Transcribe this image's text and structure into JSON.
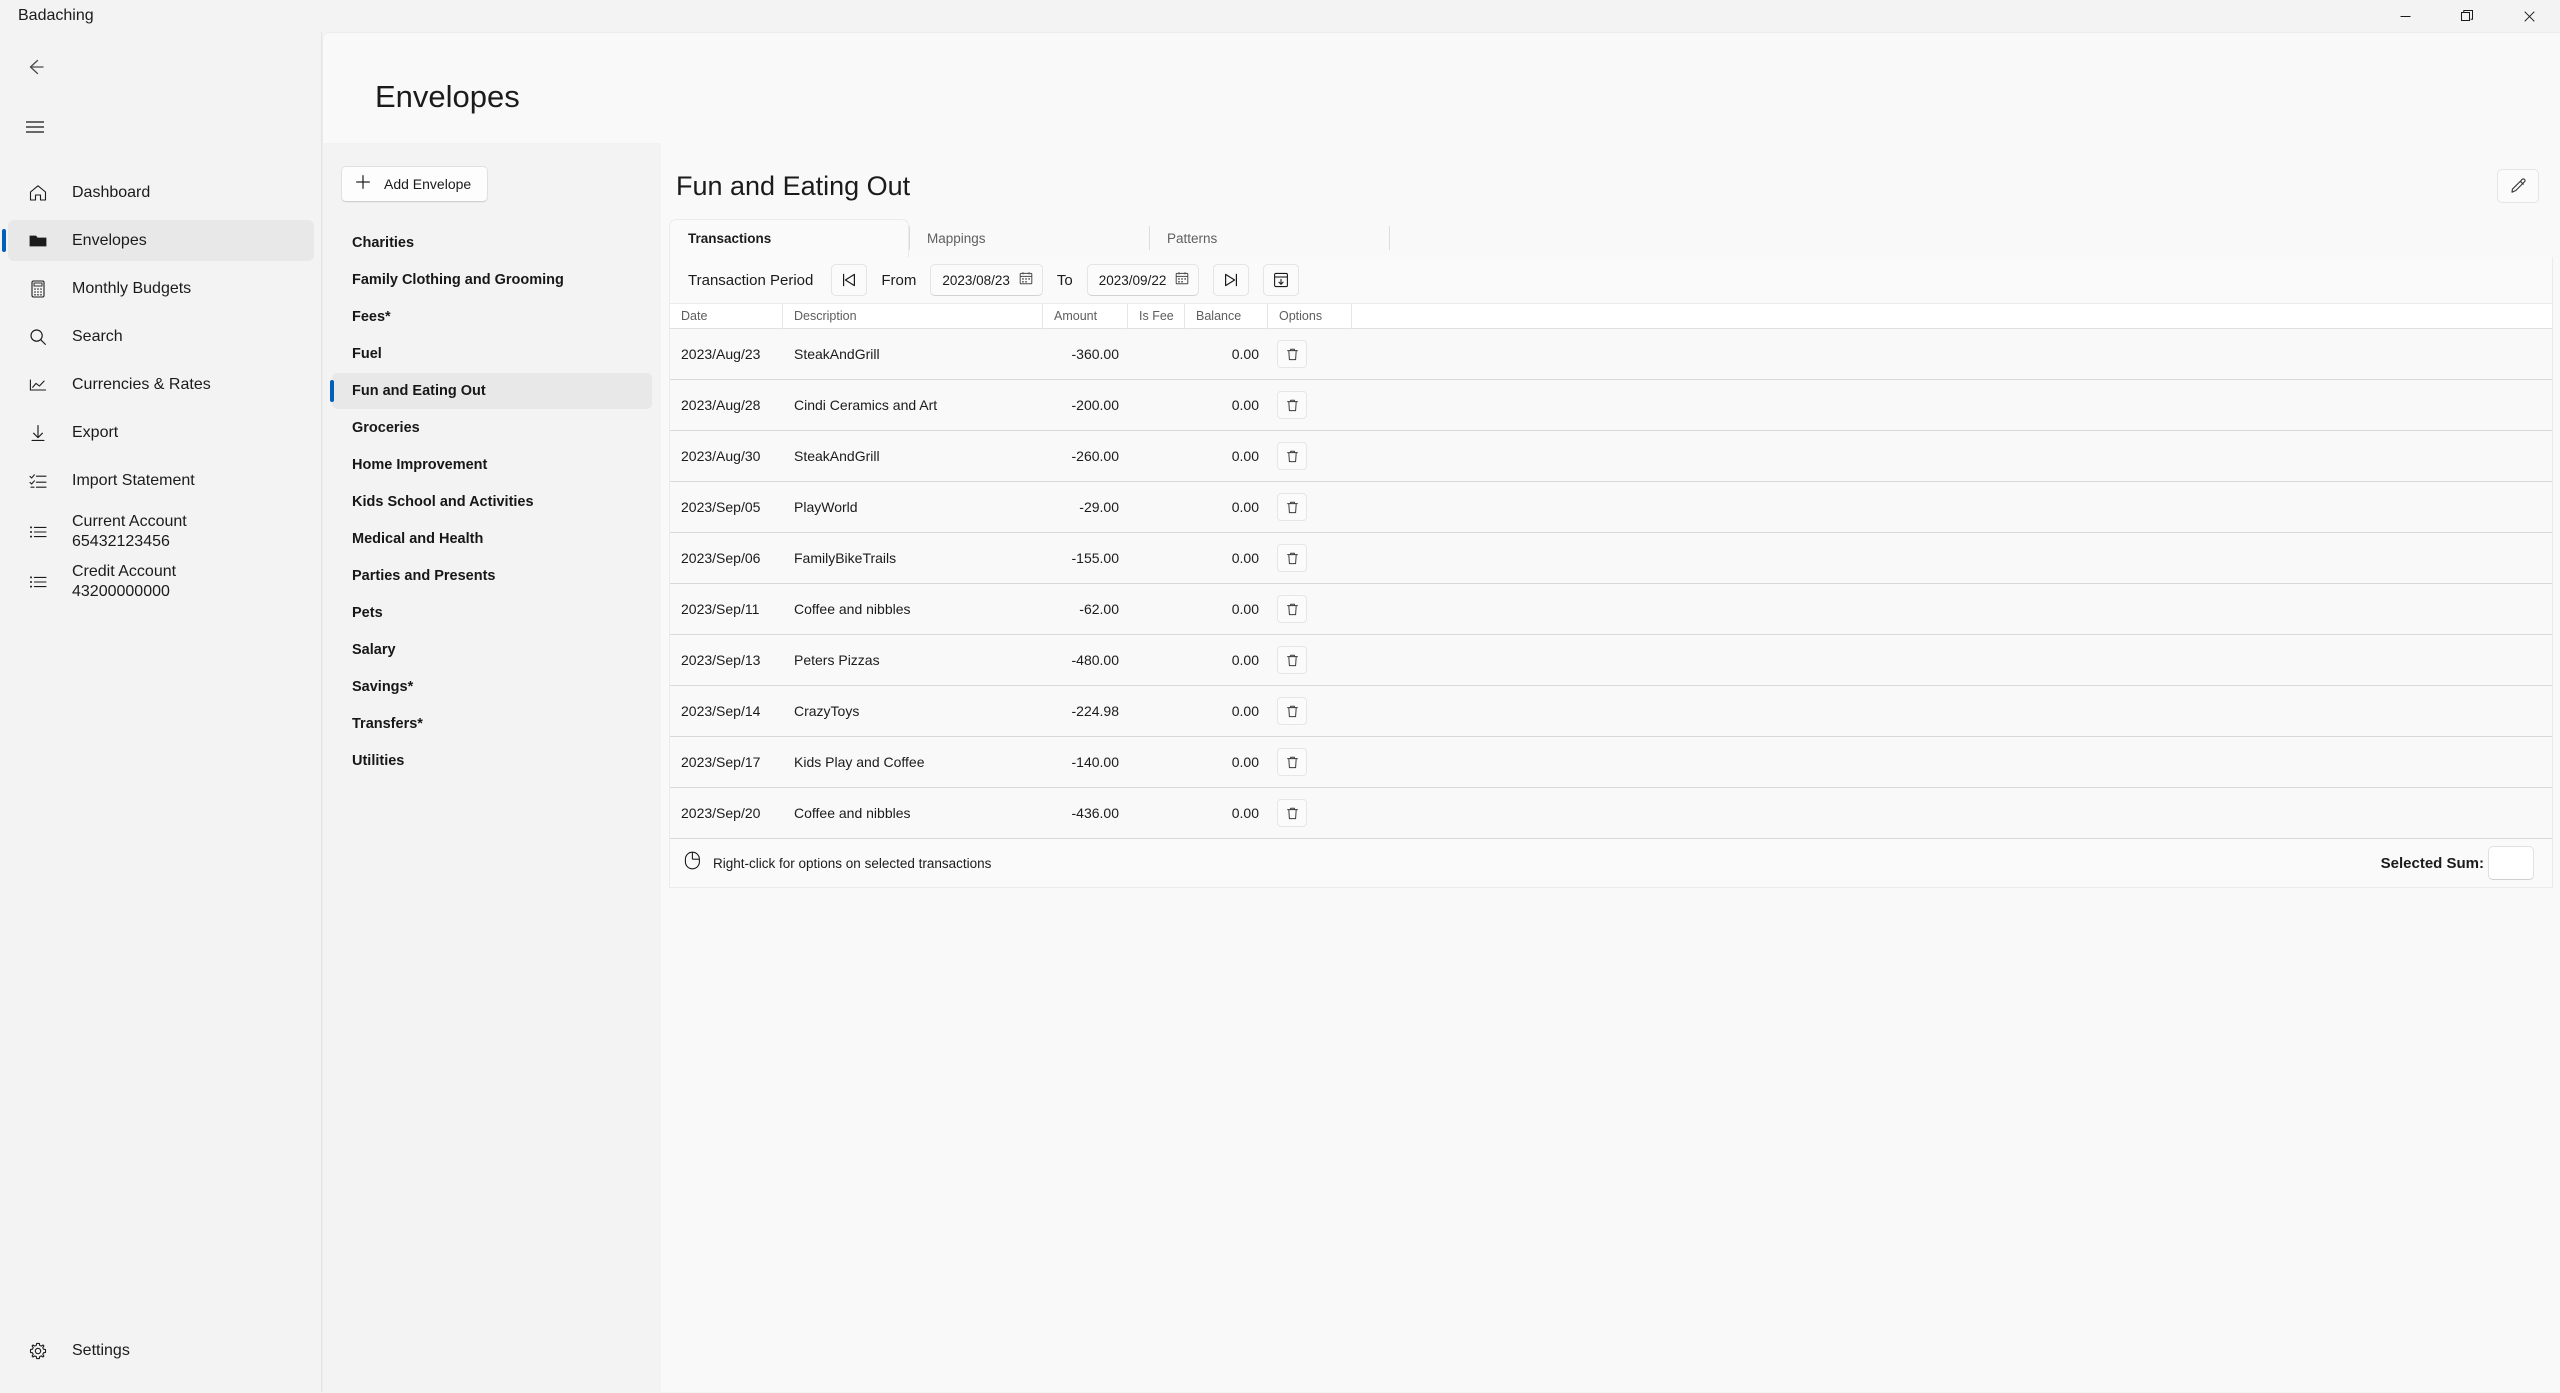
{
  "window": {
    "title": "Badaching",
    "minimize_label": "Minimize",
    "maximize_label": "Restore",
    "close_label": "Close"
  },
  "leftnav": {
    "back_label": "Back",
    "menu_label": "Navigation menu",
    "items": [
      {
        "label": "Dashboard",
        "icon": "home-icon",
        "selected": false
      },
      {
        "label": "Envelopes",
        "icon": "folder-icon",
        "selected": true
      },
      {
        "label": "Monthly Budgets",
        "icon": "calculator-icon",
        "selected": false
      },
      {
        "label": "Search",
        "icon": "search-icon",
        "selected": false
      },
      {
        "label": "Currencies & Rates",
        "icon": "chart-icon",
        "selected": false
      },
      {
        "label": "Export",
        "icon": "download-icon",
        "selected": false
      },
      {
        "label": "Import Statement",
        "icon": "checklist-icon",
        "selected": false
      },
      {
        "label": "Current Account\n65432123456",
        "icon": "list-icon",
        "selected": false
      },
      {
        "label": "Credit Account\n43200000000",
        "icon": "list-icon",
        "selected": false
      }
    ],
    "settings": {
      "label": "Settings",
      "icon": "gear-icon"
    }
  },
  "page": {
    "title": "Envelopes"
  },
  "envelopes": {
    "add_button": "Add Envelope",
    "items": [
      {
        "label": "Charities",
        "selected": false
      },
      {
        "label": "Family Clothing and Grooming",
        "selected": false
      },
      {
        "label": "Fees*",
        "selected": false
      },
      {
        "label": "Fuel",
        "selected": false
      },
      {
        "label": "Fun and Eating Out",
        "selected": true
      },
      {
        "label": "Groceries",
        "selected": false
      },
      {
        "label": "Home Improvement",
        "selected": false
      },
      {
        "label": "Kids School and Activities",
        "selected": false
      },
      {
        "label": "Medical and Health",
        "selected": false
      },
      {
        "label": "Parties and Presents",
        "selected": false
      },
      {
        "label": "Pets",
        "selected": false
      },
      {
        "label": "Salary",
        "selected": false
      },
      {
        "label": "Savings*",
        "selected": false
      },
      {
        "label": "Transfers*",
        "selected": false
      },
      {
        "label": "Utilities",
        "selected": false
      }
    ]
  },
  "detail": {
    "title": "Fun and Eating Out",
    "edit_label": "Edit envelope",
    "tabs": [
      {
        "label": "Transactions",
        "active": true
      },
      {
        "label": "Mappings",
        "active": false
      },
      {
        "label": "Patterns",
        "active": false
      }
    ],
    "toolbar": {
      "period_label": "Transaction Period",
      "prev_label": "Previous period",
      "next_label": "Next period",
      "calendar_label": "Pick period",
      "from_label": "From",
      "from_value": "2023/08/23",
      "to_label": "To",
      "to_value": "2023/09/22"
    },
    "table": {
      "columns": [
        "Date",
        "Description",
        "Amount",
        "Is Fee",
        "Balance",
        "Options"
      ],
      "rows": [
        {
          "date": "2023/Aug/23",
          "description": "SteakAndGrill",
          "amount": "-360.00",
          "is_fee": "",
          "balance": "0.00",
          "delete_label": "Delete"
        },
        {
          "date": "2023/Aug/28",
          "description": "Cindi Ceramics and Art",
          "amount": "-200.00",
          "is_fee": "",
          "balance": "0.00",
          "delete_label": "Delete"
        },
        {
          "date": "2023/Aug/30",
          "description": "SteakAndGrill",
          "amount": "-260.00",
          "is_fee": "",
          "balance": "0.00",
          "delete_label": "Delete"
        },
        {
          "date": "2023/Sep/05",
          "description": "PlayWorld",
          "amount": "-29.00",
          "is_fee": "",
          "balance": "0.00",
          "delete_label": "Delete"
        },
        {
          "date": "2023/Sep/06",
          "description": "FamilyBikeTrails",
          "amount": "-155.00",
          "is_fee": "",
          "balance": "0.00",
          "delete_label": "Delete"
        },
        {
          "date": "2023/Sep/11",
          "description": "Coffee and nibbles",
          "amount": "-62.00",
          "is_fee": "",
          "balance": "0.00",
          "delete_label": "Delete"
        },
        {
          "date": "2023/Sep/13",
          "description": "Peters Pizzas",
          "amount": "-480.00",
          "is_fee": "",
          "balance": "0.00",
          "delete_label": "Delete"
        },
        {
          "date": "2023/Sep/14",
          "description": "CrazyToys",
          "amount": "-224.98",
          "is_fee": "",
          "balance": "0.00",
          "delete_label": "Delete"
        },
        {
          "date": "2023/Sep/17",
          "description": "Kids Play and Coffee",
          "amount": "-140.00",
          "is_fee": "",
          "balance": "0.00",
          "delete_label": "Delete"
        },
        {
          "date": "2023/Sep/20",
          "description": "Coffee and nibbles",
          "amount": "-436.00",
          "is_fee": "",
          "balance": "0.00",
          "delete_label": "Delete"
        }
      ]
    },
    "footer": {
      "hint": "Right-click for options on selected transactions",
      "hint_icon": "mouse-icon",
      "sum_label": "Selected Sum:",
      "sum_value": ""
    }
  },
  "colors": {
    "accent": "#005fb8",
    "window_bg": "#f3f3f3",
    "surface": "#f9f9f9",
    "text": "#1b1b1b",
    "muted": "#5d5d5d"
  }
}
